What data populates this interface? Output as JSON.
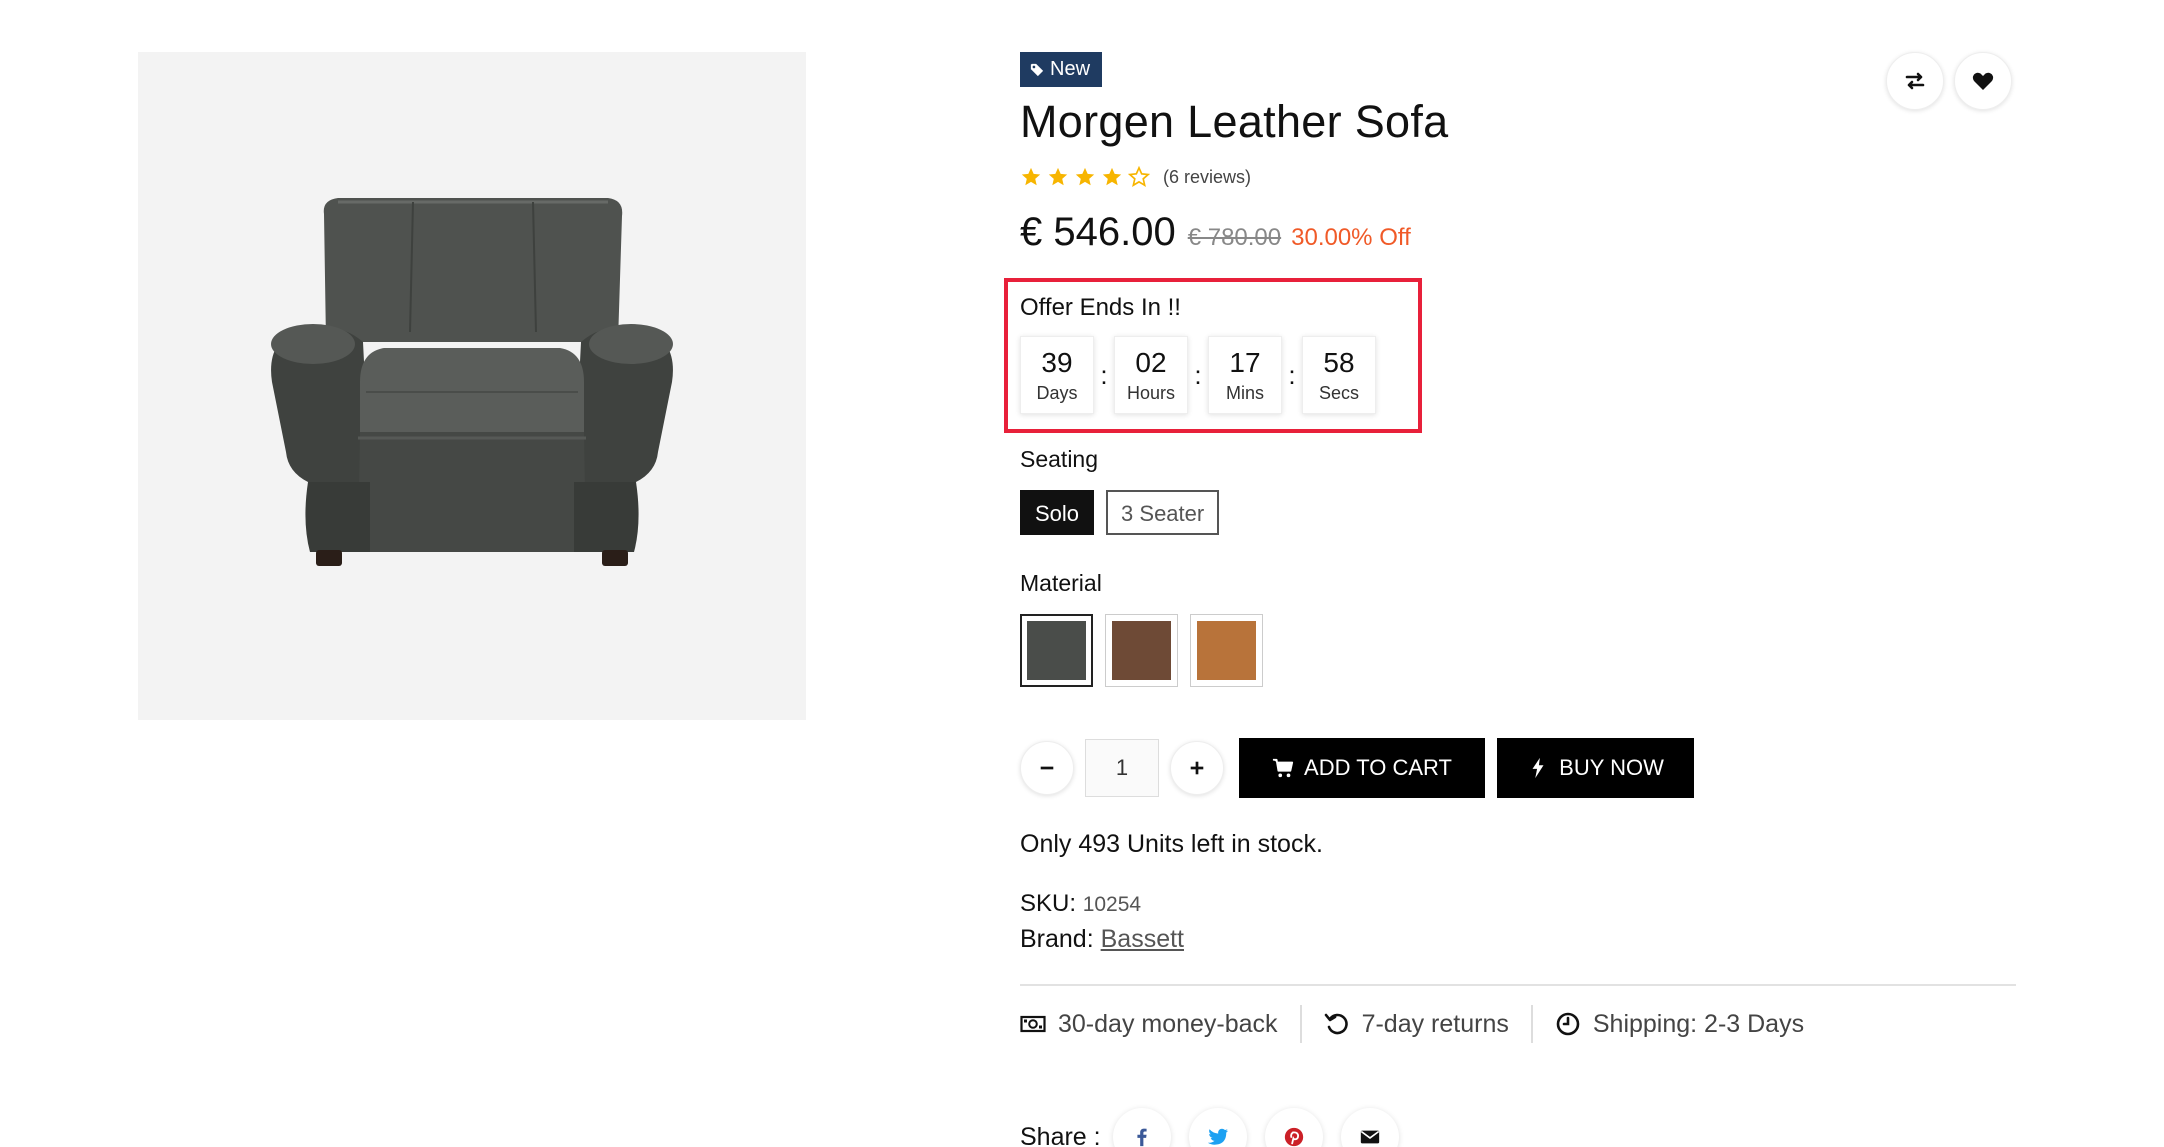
{
  "product": {
    "badge": "New",
    "title": "Morgen Leather Sofa",
    "rating": 4,
    "rating_max": 5,
    "reviews": "(6 reviews)",
    "price": "€ 546.00",
    "old_price": "€ 780.00",
    "discount": "30.00% Off"
  },
  "offer": {
    "title": "Offer Ends In !!",
    "timer": [
      {
        "value": "39",
        "label": "Days"
      },
      {
        "value": "02",
        "label": "Hours"
      },
      {
        "value": "17",
        "label": "Mins"
      },
      {
        "value": "58",
        "label": "Secs"
      }
    ],
    "separator": ":"
  },
  "seating": {
    "label": "Seating",
    "options": [
      "Solo",
      "3 Seater"
    ],
    "selected": "Solo"
  },
  "material": {
    "label": "Material",
    "swatches": [
      {
        "name": "charcoal",
        "color": "#4a4d4a"
      },
      {
        "name": "brown",
        "color": "#6e4a36"
      },
      {
        "name": "tan",
        "color": "#b8733a"
      }
    ],
    "selected": "charcoal"
  },
  "cart": {
    "quantity": "1",
    "add_to_cart": "ADD TO CART",
    "buy_now": "BUY NOW"
  },
  "stock_text": "Only 493 Units left in stock.",
  "sku": {
    "label": "SKU:",
    "value": "10254"
  },
  "brand": {
    "label": "Brand:",
    "value": "Bassett"
  },
  "features": [
    {
      "icon": "money-icon",
      "text": "30-day money-back"
    },
    {
      "icon": "returns-icon",
      "text": "7-day returns"
    },
    {
      "icon": "clock-icon",
      "text": "Shipping: 2-3 Days"
    }
  ],
  "share": {
    "label": "Share :",
    "networks": [
      "facebook",
      "twitter",
      "pinterest",
      "email"
    ]
  },
  "colors": {
    "badge": "#1f3b61",
    "discount": "#f05a28",
    "offer_border": "#e8203a",
    "star": "#f7b500",
    "facebook": "#3b5998",
    "twitter": "#1da1f2",
    "pinterest": "#cb2027"
  }
}
